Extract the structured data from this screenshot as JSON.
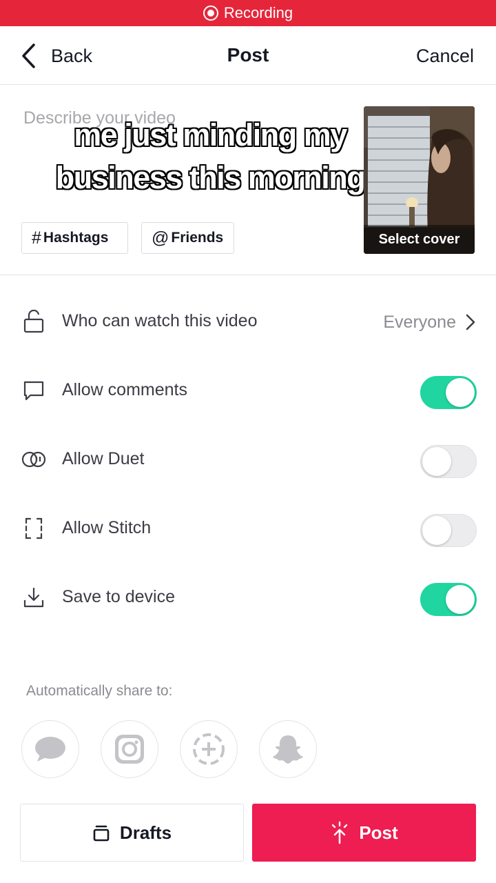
{
  "status_bar": {
    "recording_label": "Recording"
  },
  "nav": {
    "back_label": "Back",
    "title": "Post",
    "cancel_label": "Cancel"
  },
  "description": {
    "placeholder": "Describe your video",
    "overlay_caption": "me just minding my business this morning",
    "hashtags_label": "Hashtags",
    "hashtags_symbol": "#",
    "friends_label": "Friends",
    "friends_symbol": "@",
    "cover_label": "Select cover"
  },
  "settings": [
    {
      "icon": "lock-icon",
      "label": "Who can watch this video",
      "value": "Everyone"
    },
    {
      "icon": "comment-icon",
      "label": "Allow comments",
      "enabled": true
    },
    {
      "icon": "duet-icon",
      "label": "Allow Duet",
      "enabled": false
    },
    {
      "icon": "stitch-icon",
      "label": "Allow Stitch",
      "enabled": false
    },
    {
      "icon": "download-icon",
      "label": "Save to device",
      "enabled": true
    }
  ],
  "share": {
    "label": "Automatically share to:",
    "targets": [
      "messages-icon",
      "instagram-icon",
      "story-add-icon",
      "snapchat-icon"
    ]
  },
  "actions": {
    "drafts_label": "Drafts",
    "post_label": "Post"
  },
  "colors": {
    "accent": "#ee1d52",
    "toggle_on": "#20d5a0",
    "recording": "#e5263a"
  }
}
